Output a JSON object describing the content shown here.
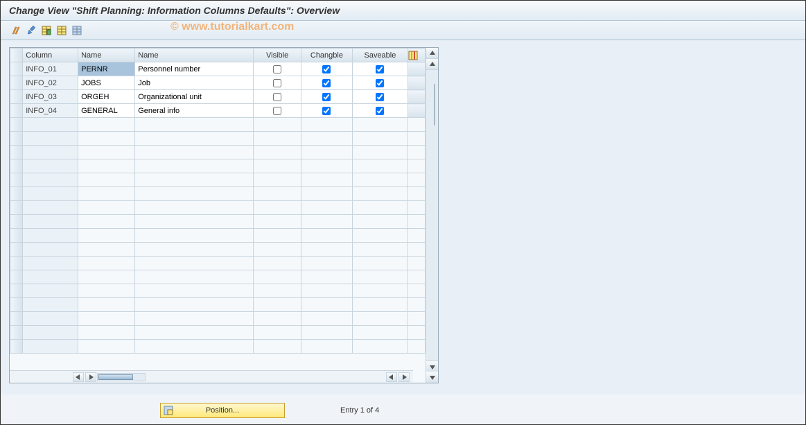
{
  "title": "Change View \"Shift Planning: Information Columns Defaults\": Overview",
  "watermark": "© www.tutorialkart.com",
  "toolbar": {
    "btn1": "display-change-icon",
    "btn2": "change-icon",
    "btn3": "new-entries-icon",
    "btn4": "copy-icon",
    "btn5": "delete-icon"
  },
  "table": {
    "headers": {
      "column": "Column",
      "name1": "Name",
      "name2": "Name",
      "visible": "Visible",
      "changeable": "Changble",
      "saveable": "Saveable"
    },
    "rows": [
      {
        "column": "INFO_01",
        "name1": "PERNR",
        "name2": "Personnel number",
        "visible": false,
        "changeable": true,
        "saveable": true,
        "highlighted": true
      },
      {
        "column": "INFO_02",
        "name1": "JOBS",
        "name2": "Job",
        "visible": false,
        "changeable": true,
        "saveable": true,
        "highlighted": false
      },
      {
        "column": "INFO_03",
        "name1": "ORGEH",
        "name2": "Organizational unit",
        "visible": false,
        "changeable": true,
        "saveable": true,
        "highlighted": false
      },
      {
        "column": "INFO_04",
        "name1": "GENERAL",
        "name2": "General info",
        "visible": false,
        "changeable": true,
        "saveable": true,
        "highlighted": false
      }
    ],
    "empty_rows": 17
  },
  "footer": {
    "position_button": "Position...",
    "entry_status": "Entry 1 of 4"
  }
}
